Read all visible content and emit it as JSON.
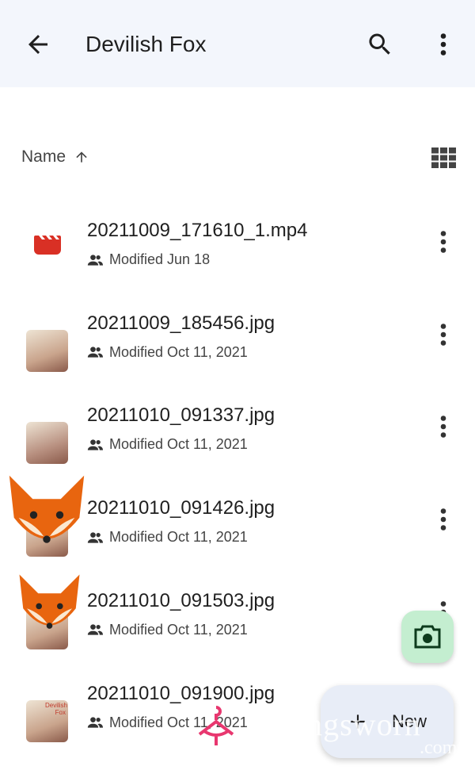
{
  "header": {
    "title": "Devilish Fox",
    "back_icon": "arrow-left-icon",
    "search_icon": "search-icon",
    "more_icon": "more-vert-icon"
  },
  "sort": {
    "label": "Name",
    "direction_icon": "arrow-up-icon",
    "view_icon": "grid-view-icon"
  },
  "files": [
    {
      "name": "20211009_171610_1.mp4",
      "modified": "Modified Jun 18",
      "type": "video",
      "thumb_color": "#d93025"
    },
    {
      "name": "20211009_185456.jpg",
      "modified": "Modified Oct 11, 2021",
      "type": "image",
      "thumb_color": "#c9a48c"
    },
    {
      "name": "20211010_091337.jpg",
      "modified": "Modified Oct 11, 2021",
      "type": "image",
      "thumb_color": "#b89080"
    },
    {
      "name": "20211010_091426.jpg",
      "modified": "Modified Oct 11, 2021",
      "type": "image",
      "thumb_color": "#c9a48c"
    },
    {
      "name": "20211010_091503.jpg",
      "modified": "Modified Oct 11, 2021",
      "type": "image",
      "thumb_color": "#c9a48c"
    },
    {
      "name": "20211010_091900.jpg",
      "modified": "Modified Oct 11, 2021",
      "type": "image",
      "thumb_color": "#c9a48c",
      "thumb_text": "Devilish Fox"
    }
  ],
  "fab": {
    "camera_icon": "camera-icon",
    "new_label": "New",
    "plus_icon": "plus-icon"
  },
  "watermark": {
    "text": "ingsworn",
    "suffix": ".com"
  },
  "colors": {
    "header_bg": "#f3f6fc",
    "camera_fab": "#c4eed0",
    "new_fab": "#e8edf7",
    "video_red": "#d93025"
  }
}
